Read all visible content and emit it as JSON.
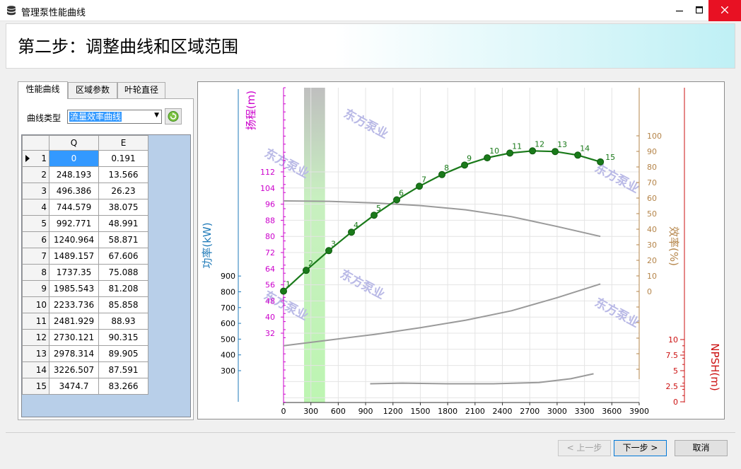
{
  "window": {
    "title": "管理泵性能曲线"
  },
  "header": {
    "step_title": "第二步：调整曲线和区域范围"
  },
  "tabs": [
    "性能曲线",
    "区域参数",
    "叶轮直径"
  ],
  "panel": {
    "curve_type_label": "曲线类型",
    "curve_type_value": "流量效率曲线"
  },
  "table": {
    "columns": [
      "Q",
      "E"
    ],
    "rows": [
      [
        "1",
        "0",
        "0.191"
      ],
      [
        "2",
        "248.193",
        "13.566"
      ],
      [
        "3",
        "496.386",
        "26.23"
      ],
      [
        "4",
        "744.579",
        "38.075"
      ],
      [
        "5",
        "992.771",
        "48.991"
      ],
      [
        "6",
        "1240.964",
        "58.871"
      ],
      [
        "7",
        "1489.157",
        "67.606"
      ],
      [
        "8",
        "1737.35",
        "75.088"
      ],
      [
        "9",
        "1985.543",
        "81.208"
      ],
      [
        "10",
        "2233.736",
        "85.858"
      ],
      [
        "11",
        "2481.929",
        "88.93"
      ],
      [
        "12",
        "2730.121",
        "90.315"
      ],
      [
        "13",
        "2978.314",
        "89.905"
      ],
      [
        "14",
        "3226.507",
        "87.591"
      ],
      [
        "15",
        "3474.7",
        "83.266"
      ]
    ]
  },
  "buttons": {
    "prev": "< 上一步",
    "next": "下一步 >",
    "cancel": "取消"
  },
  "colors": {
    "head": "#cc00cc",
    "power": "#1f7ab8",
    "efficiency": "#b5854a",
    "npsh": "#cc1111",
    "curve": "#1a7a1a",
    "ref": "#9a9a9a",
    "band": "#c8f5c0"
  },
  "chart_data": {
    "type": "line",
    "xlim": [
      0,
      3900
    ],
    "xticks": [
      "0",
      "300",
      "600",
      "900",
      "1200",
      "1500",
      "1800",
      "2100",
      "2400",
      "2700",
      "3000",
      "3300",
      "3600",
      "3900"
    ],
    "axes": {
      "head": {
        "label": "扬程(m)",
        "ylim": [
          32,
          112
        ],
        "ticks": [
          "32",
          "40",
          "48",
          "56",
          "64",
          "72",
          "80",
          "88",
          "96",
          "104",
          "112"
        ]
      },
      "power": {
        "label": "功率(kW)",
        "ylim": [
          300,
          900
        ],
        "ticks": [
          "300",
          "400",
          "500",
          "600",
          "700",
          "800",
          "900"
        ]
      },
      "efficiency": {
        "label": "效率(%)",
        "ylim": [
          0,
          100
        ],
        "ticks": [
          "0",
          "10",
          "20",
          "30",
          "40",
          "50",
          "60",
          "70",
          "80",
          "90",
          "100"
        ]
      },
      "npsh": {
        "label": "NPSH(m)",
        "ylim": [
          0,
          10
        ],
        "ticks": [
          "0",
          "2.5",
          "5",
          "7.5",
          "10"
        ]
      }
    },
    "highlight_band_q": [
      225,
      455
    ],
    "efficiency_points": {
      "labels": [
        "1",
        "2",
        "3",
        "4",
        "5",
        "6",
        "7",
        "8",
        "9",
        "10",
        "11",
        "12",
        "13",
        "14",
        "15"
      ],
      "x": [
        0,
        248.193,
        496.386,
        744.579,
        992.771,
        1240.964,
        1489.157,
        1737.35,
        1985.543,
        2233.736,
        2481.929,
        2730.121,
        2978.314,
        3226.507,
        3474.7
      ],
      "y": [
        0.191,
        13.566,
        26.23,
        38.075,
        48.991,
        58.871,
        67.606,
        75.088,
        81.208,
        85.858,
        88.93,
        90.315,
        89.905,
        87.591,
        83.266
      ]
    },
    "head_curve": {
      "x": [
        0,
        500,
        1000,
        1500,
        2000,
        2500,
        3000,
        3474.7
      ],
      "y": [
        97.6,
        97.4,
        96.6,
        95.3,
        93.2,
        89.8,
        84.9,
        80
      ]
    },
    "power_curve": {
      "x": [
        0,
        500,
        1000,
        1500,
        2000,
        2500,
        3000,
        3474.7
      ],
      "y": [
        458,
        494,
        530,
        572,
        620,
        680,
        763,
        850
      ]
    },
    "npsh_curve": {
      "x": [
        950,
        1300,
        1800,
        2300,
        2800,
        3150,
        3400
      ],
      "y": [
        2.9,
        3.0,
        2.9,
        2.9,
        3.1,
        3.7,
        4.5
      ]
    },
    "watermarks": [
      "东方泵业",
      "东方泵业",
      "东方泵业",
      "东方泵业",
      "东方泵业"
    ]
  }
}
